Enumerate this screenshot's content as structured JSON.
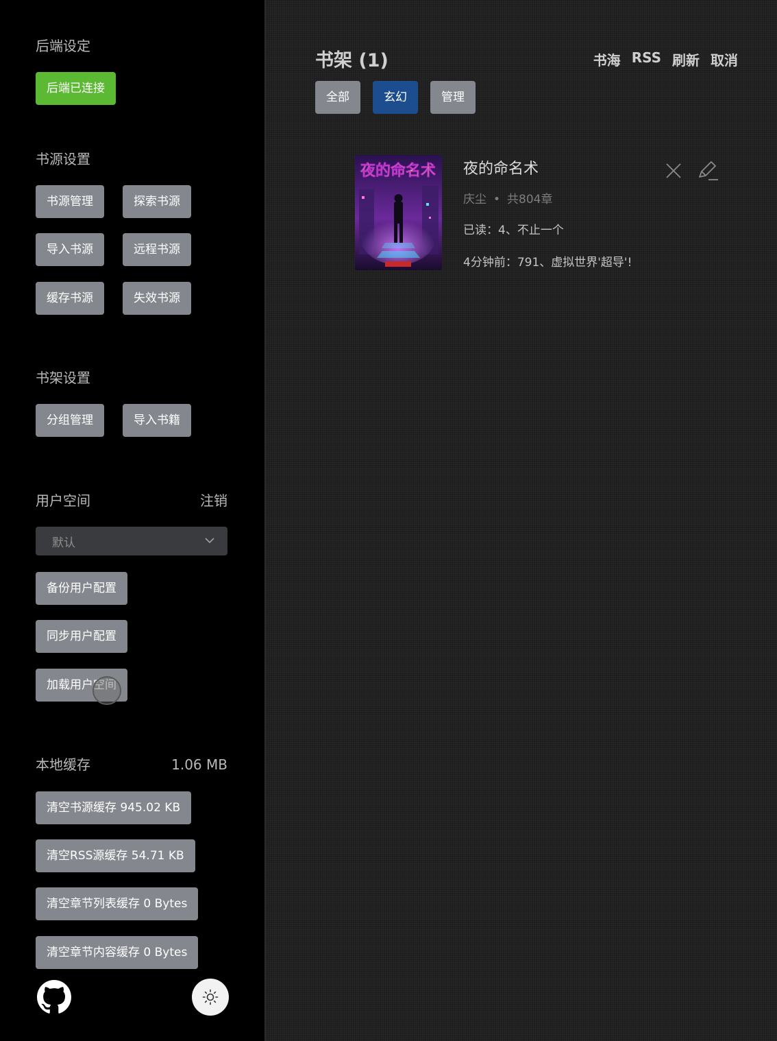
{
  "sidebar": {
    "backend": {
      "title": "后端设定",
      "status_button": "后端已连接"
    },
    "book_source": {
      "title": "书源设置",
      "buttons": [
        "书源管理",
        "探索书源",
        "导入书源",
        "远程书源",
        "缓存书源",
        "失效书源"
      ]
    },
    "shelf_settings": {
      "title": "书架设置",
      "buttons": [
        "分组管理",
        "导入书籍"
      ]
    },
    "user_space": {
      "title": "用户空间",
      "logout": "注销",
      "select_value": "默认",
      "buttons": [
        "备份用户配置",
        "同步用户配置",
        "加载用户空间"
      ]
    },
    "local_cache": {
      "title": "本地缓存",
      "size": "1.06 MB",
      "buttons": [
        "清空书源缓存 945.02 KB",
        "清空RSS源缓存 54.71 KB",
        "清空章节列表缓存 0 Bytes",
        "清空章节内容缓存 0 Bytes"
      ]
    },
    "footer": {
      "github_icon": "github-icon",
      "theme_icon": "sun-icon"
    }
  },
  "main": {
    "title": "书架 (1)",
    "nav": [
      "书海",
      "RSS",
      "刷新",
      "取消"
    ],
    "tabs": [
      {
        "label": "全部",
        "active": false
      },
      {
        "label": "玄幻",
        "active": true
      },
      {
        "label": "管理",
        "active": false
      }
    ],
    "books": [
      {
        "title": "夜的命名术",
        "cover_text": "夜的命名术",
        "author": "庆尘",
        "dot": "•",
        "chapters": "共804章",
        "read": "已读：4、不止一个",
        "latest": "4分钟前：791、虚拟世界'超导'!"
      }
    ]
  },
  "colors": {
    "sidebar_bg": "#000000",
    "main_bg": "#1e1e1e",
    "button_gray": "#84888e",
    "button_green": "#5cb934",
    "tab_active": "#1c4e8f"
  }
}
